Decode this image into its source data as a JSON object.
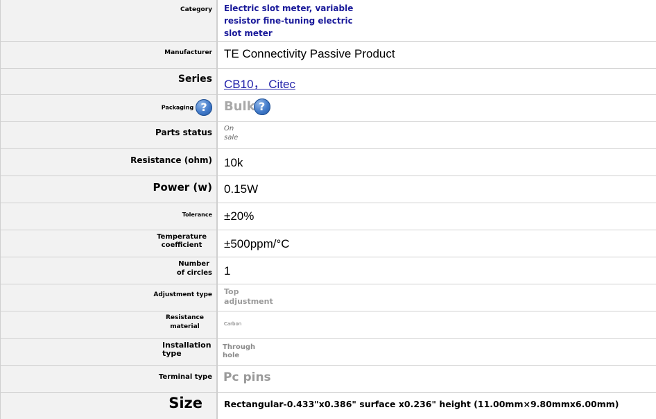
{
  "rows": {
    "category": {
      "label": "Category",
      "value": "Electric slot meter, variable resistor fine-tuning electric slot meter",
      "value_lines": [
        "Electric slot meter, variable",
        "resistor fine-tuning electric",
        "slot meter"
      ]
    },
    "manufacturer": {
      "label": "Manufacturer",
      "value": "TE Connectivity Passive Product"
    },
    "series": {
      "label": "Series",
      "value": "CB10， Citec"
    },
    "packaging": {
      "label": "Packaging",
      "value": "Bulk",
      "help_icon": "question-mark-help-icon"
    },
    "parts_status": {
      "label": "Parts status",
      "value_lines": [
        "On",
        "sale"
      ]
    },
    "resistance": {
      "label": "Resistance (ohm)",
      "value": "10k"
    },
    "power": {
      "label": "Power (w)",
      "value": "0.15W"
    },
    "tolerance": {
      "label": "Tolerance",
      "value": "±20%"
    },
    "temperature_coefficient": {
      "label_lines": [
        "Temperature",
        "coefficient"
      ],
      "value": "±500ppm/°C"
    },
    "number_of_circles": {
      "label_lines": [
        "Number",
        "of circles"
      ],
      "value": "1"
    },
    "adjustment_type": {
      "label": "Adjustment type",
      "value_lines": [
        "Top",
        "adjustment"
      ]
    },
    "resistance_material": {
      "label_lines": [
        "Resistance",
        "material"
      ],
      "value": "Carbon"
    },
    "installation_type": {
      "label_lines": [
        "Installation",
        "type"
      ],
      "value_lines": [
        "Through",
        "hole"
      ]
    },
    "terminal_type": {
      "label": "Terminal type",
      "value": "Pc pins"
    },
    "size": {
      "label": "Size",
      "value": "Rectangular-0.433\"x0.386\" surface x0.236\" height (11.00mm×9.80mmx6.00mm)"
    }
  },
  "colors": {
    "link": "#2222aa",
    "category_text": "#1a1a9a",
    "muted": "#9a9a9a",
    "label_bg": "#f2f2f2",
    "help_icon": "#3f78c8"
  }
}
